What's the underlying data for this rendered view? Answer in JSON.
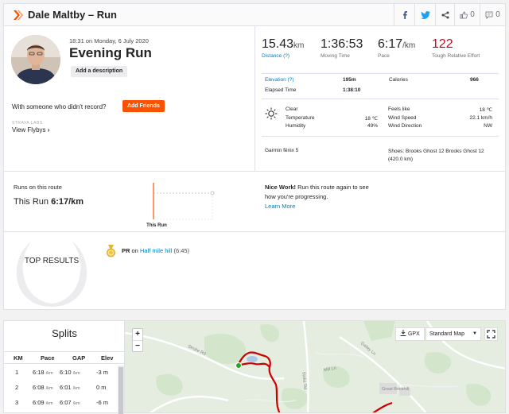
{
  "header": {
    "athlete_activity": "Dale Maltby – Run",
    "kudos_count": "0",
    "comments_count": "0"
  },
  "activity": {
    "datetime": "18:31 on Monday, 6 July 2020",
    "title": "Evening Run",
    "description_button": "Add a description",
    "with_someone": "With someone who didn't record?",
    "add_friends_button": "Add Friends",
    "strava_labs": "STRAVA LABS",
    "view_flybys": "View Flybys"
  },
  "stats": {
    "distance_value": "15.43",
    "distance_unit": "km",
    "distance_label": "Distance (?)",
    "moving_time_value": "1:36:53",
    "moving_time_label": "Moving Time",
    "pace_value": "6:17",
    "pace_unit": "/km",
    "pace_label": "Pace",
    "effort_value": "122",
    "effort_label": "Tough Relative Effort",
    "elevation_label": "Elevation (?)",
    "elevation_value": "195m",
    "calories_label": "Calories",
    "calories_value": "966",
    "elapsed_label": "Elapsed Time",
    "elapsed_value": "1:38:10"
  },
  "weather": {
    "condition": "Clear",
    "temperature_label": "Temperature",
    "temperature_value": "18 ℃",
    "humidity_label": "Humidity",
    "humidity_value": "49%",
    "feels_like_label": "Feels like",
    "feels_like_value": "18 ℃",
    "wind_speed_label": "Wind Speed",
    "wind_speed_value": "22.1 km/h",
    "wind_direction_label": "Wind Direction",
    "wind_direction_value": "NW"
  },
  "gear": {
    "device": "Garmin fēnix 5",
    "shoes": "Shoes: Brooks Ghost 12 Brooks Ghost 12 (420.0 km)"
  },
  "route": {
    "runs_label": "Runs on this route",
    "this_run_label": "This Run",
    "this_run_pace": "6:17/km",
    "chart_marker_label": "This Run",
    "nice_work_bold": "Nice Work!",
    "nice_work_text": " Run this route again to see how you're progressing.",
    "learn_more": "Learn More"
  },
  "results": {
    "heading": "TOP RESULTS",
    "pr_label": "PR",
    "pr_on": " on ",
    "segment_name": "Half mile hill",
    "segment_time": " (6:45)"
  },
  "splits": {
    "title": "Splits",
    "columns": [
      "KM",
      "Pace",
      "GAP",
      "Elev"
    ],
    "rows": [
      {
        "km": "1",
        "pace": "6:18",
        "gap": "6:10",
        "elev": "-3 m"
      },
      {
        "km": "2",
        "pace": "6:08",
        "gap": "6:01",
        "elev": "0 m"
      },
      {
        "km": "3",
        "pace": "6:09",
        "gap": "6:07",
        "elev": "-6 m"
      }
    ],
    "pace_unit": "/km"
  },
  "map": {
    "zoom_in": "+",
    "zoom_out": "−",
    "gpx_label": "GPX",
    "map_type": "Standard Map",
    "labels": [
      "Stroke Rd",
      "Galley Ln",
      "Great Brickhill",
      "Stoke Rd",
      "Mill Ln"
    ]
  },
  "colors": {
    "brand": "#fc5200",
    "link": "#007fb6",
    "effort": "#d0021b",
    "route": "#cc0000",
    "start_marker": "#22a722"
  },
  "icons": [
    "strava-chevron-icon",
    "facebook-icon",
    "twitter-icon",
    "share-icon",
    "kudos-icon",
    "comment-icon",
    "sun-icon",
    "medal-icon",
    "download-icon",
    "fullscreen-icon"
  ]
}
